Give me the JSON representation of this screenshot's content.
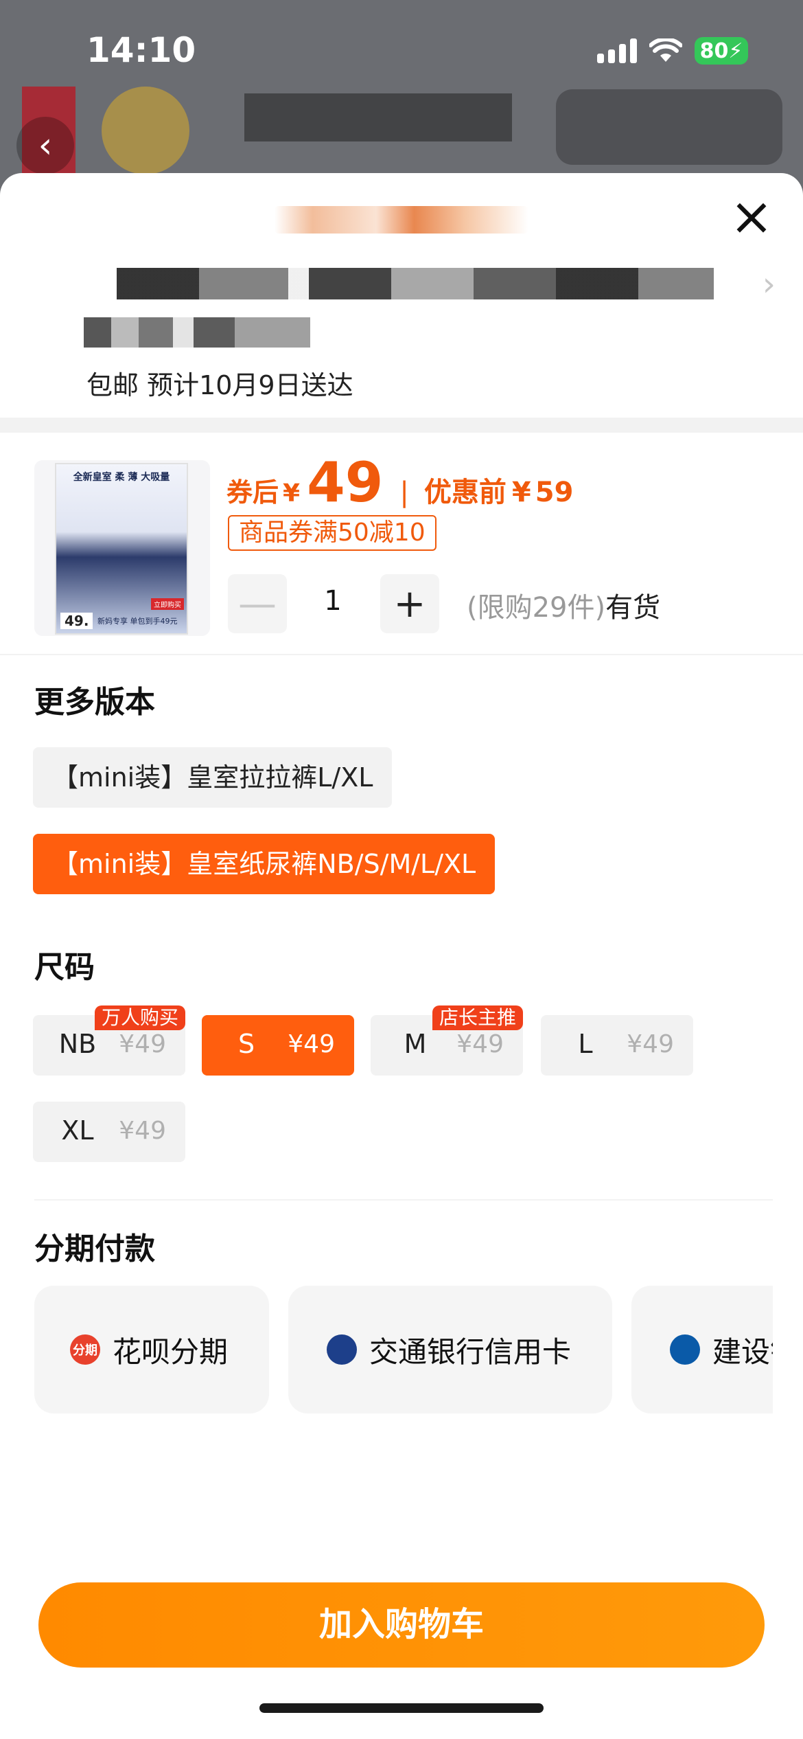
{
  "status_bar": {
    "time": "14:10",
    "battery": "80"
  },
  "sheet": {
    "delivery_text": "包邮 预计10月9日送达",
    "product": {
      "image": {
        "headline": "全新皇室 柔 薄 大吸量",
        "price_tag": "49.",
        "foot_text": "新妈专享 单包到手49元",
        "corner_tag": "立即购买"
      },
      "after_coupon_label": "券后",
      "currency": "¥",
      "price": "49",
      "separator": "|",
      "before_label": "优惠前",
      "original_price": "59",
      "coupon_text": "商品券满50减10",
      "quantity": "1",
      "stock_limit": "(限购29件)",
      "stock_status": "有货"
    },
    "versions": {
      "title": "更多版本",
      "options": [
        {
          "label": "【mini装】皇室拉拉裤L/XL",
          "selected": false
        },
        {
          "label": "【mini装】皇室纸尿裤NB/S/M/L/XL",
          "selected": true
        }
      ]
    },
    "sizes": {
      "title": "尺码",
      "options": [
        {
          "name": "NB",
          "price": "¥49",
          "badge": "万人购买",
          "selected": false
        },
        {
          "name": "S",
          "price": "¥49",
          "badge": "",
          "selected": true
        },
        {
          "name": "M",
          "price": "¥49",
          "badge": "店长主推",
          "selected": false
        },
        {
          "name": "L",
          "price": "¥49",
          "badge": "",
          "selected": false
        },
        {
          "name": "XL",
          "price": "¥49",
          "badge": "",
          "selected": false
        }
      ]
    },
    "installments": {
      "title": "分期付款",
      "options": [
        {
          "label": "花呗分期",
          "icon": "huabei-icon",
          "icon_text": "分期",
          "icon_color": "#e8412c"
        },
        {
          "label": "交通银行信用卡",
          "icon": "bocom-icon",
          "icon_text": "",
          "icon_color": "#1d3f8a"
        },
        {
          "label": "建设银行",
          "icon": "ccb-icon",
          "icon_text": "",
          "icon_color": "#0a5aa8"
        }
      ]
    },
    "add_to_cart": "加入购物车"
  },
  "colors": {
    "accent": "#ff5e0e",
    "price": "#f05a0c",
    "cart_button": "#ff8a00"
  }
}
